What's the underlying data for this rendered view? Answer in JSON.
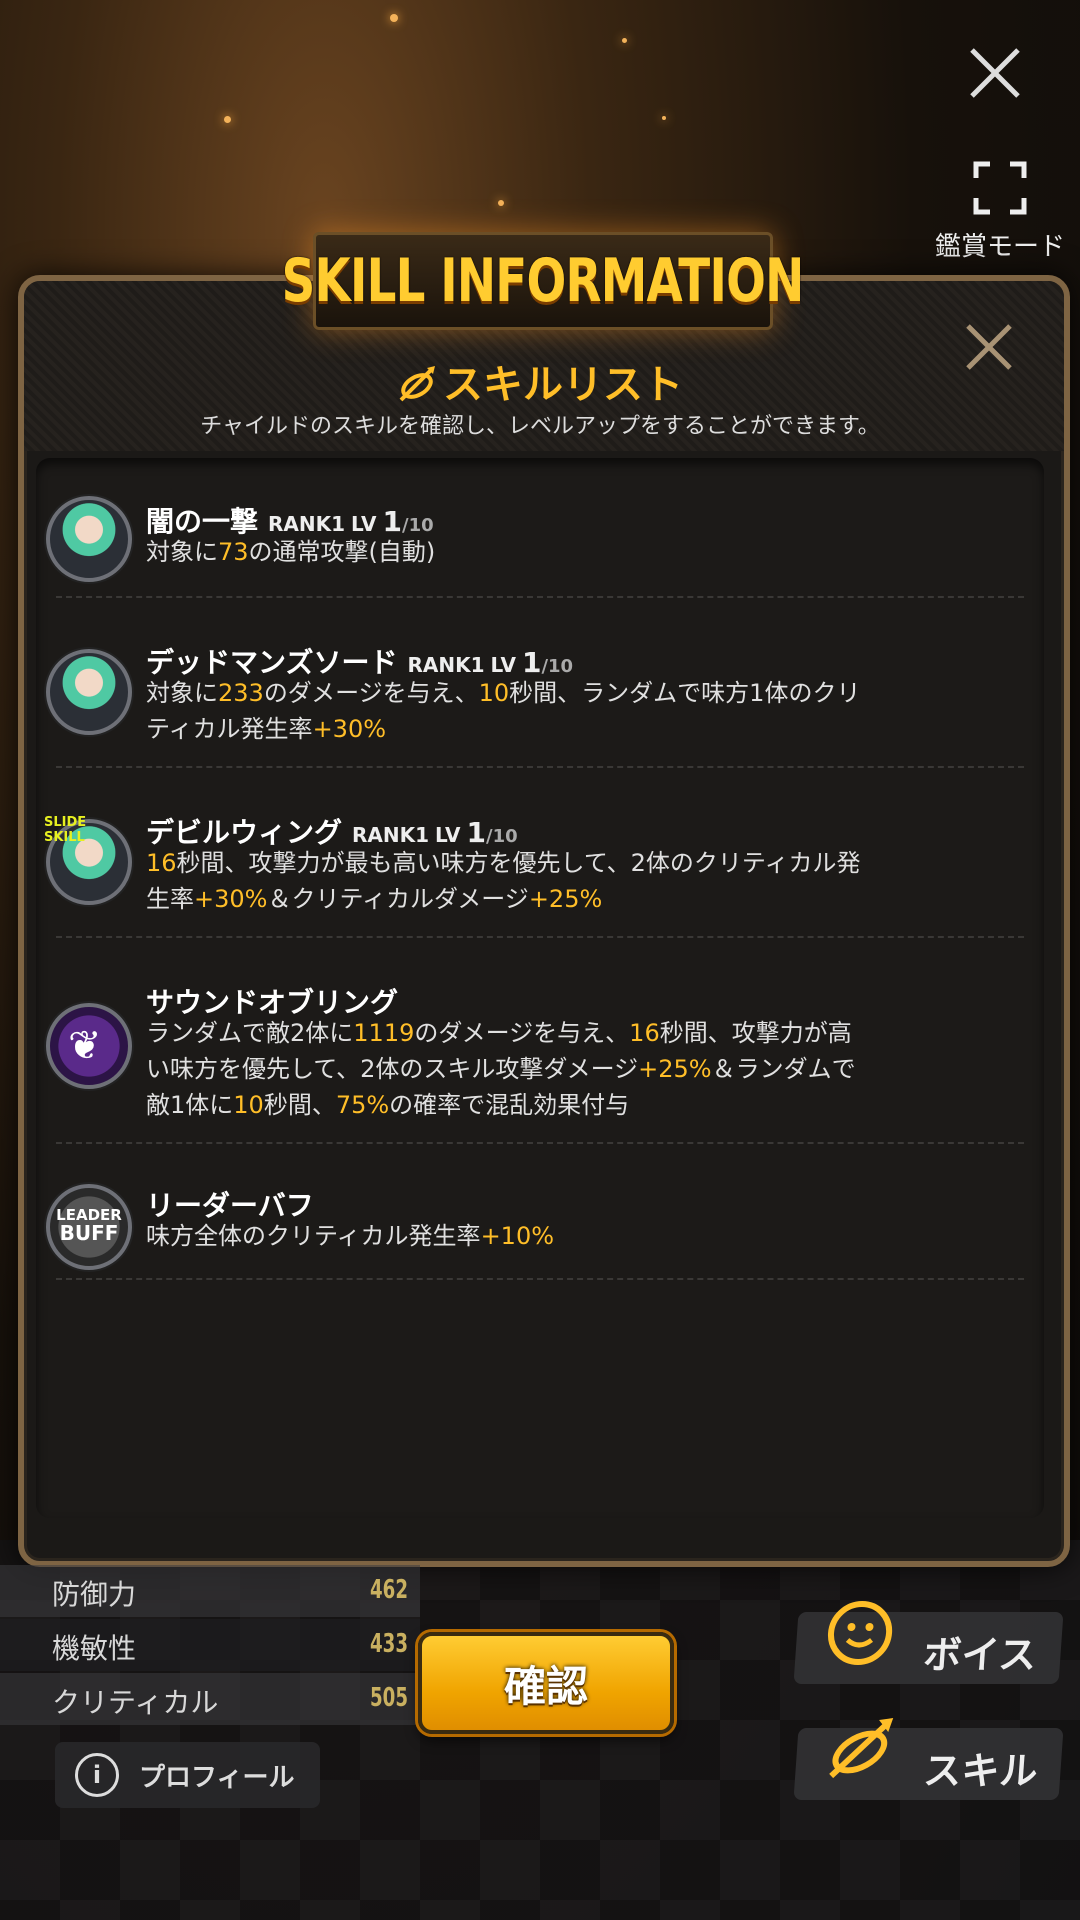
{
  "window": {
    "close_icon": "close-icon",
    "view_mode_label": "鑑賞モード"
  },
  "panel": {
    "title_banner": "SKILL INFORMATION",
    "list_title": "スキルリスト",
    "list_subtitle": "チャイルドのスキルを確認し、レベルアップをすることができます。"
  },
  "skills": [
    {
      "name": "闇の一撃",
      "rank": "RANK1",
      "lv_prefix": "LV",
      "lv": "1",
      "lv_max": "/10",
      "desc_parts": [
        "対象に",
        "73",
        "の通常攻撃(自動)"
      ]
    },
    {
      "name": "デッドマンズソード",
      "rank": "RANK1",
      "lv_prefix": "LV",
      "lv": "1",
      "lv_max": "/10",
      "desc_parts": [
        "対象に",
        "233",
        "のダメージを与え、",
        "10",
        "秒間、ランダムで味方1体のクリティカル発生率",
        "+30%",
        ""
      ]
    },
    {
      "name": "デビルウィング",
      "badge": "SLIDE SKILL",
      "rank": "RANK1",
      "lv_prefix": "LV",
      "lv": "1",
      "lv_max": "/10",
      "desc_parts": [
        "",
        "16",
        "秒間、攻撃力が最も高い味方を優先して、2体のクリティカル発生率",
        "+30%",
        "＆クリティカルダメージ",
        "+25%",
        ""
      ]
    },
    {
      "name": "サウンドオブリング",
      "desc_parts": [
        "ランダムで敵2体に",
        "1119",
        "のダメージを与え、",
        "16",
        "秒間、攻撃力が高い味方を優先して、2体のスキル攻撃ダメージ",
        "+25%",
        "＆ランダムで敵1体に",
        "10",
        "秒間、",
        "75%",
        "の確率で混乱効果付与"
      ]
    },
    {
      "name": "リーダーバフ",
      "badge_line1": "LEADER",
      "badge_line2": "BUFF",
      "desc_parts": [
        "味方全体のクリティカル発生率",
        "+10%",
        ""
      ]
    }
  ],
  "stats": [
    {
      "label": "防御力",
      "value": "462"
    },
    {
      "label": "機敏性",
      "value": "433"
    },
    {
      "label": "クリティカル",
      "value": "505"
    }
  ],
  "buttons": {
    "confirm": "確認",
    "profile": "プロフィール",
    "voice": "ボイス",
    "skill": "スキル"
  },
  "colors": {
    "accent": "#ffbe28",
    "panel_border": "#7e6443",
    "confirm": "#f0a400"
  }
}
